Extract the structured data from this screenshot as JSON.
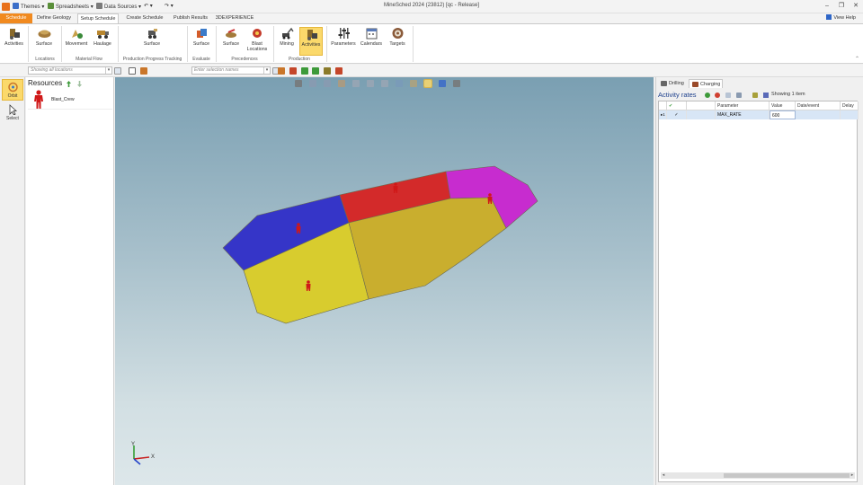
{
  "titlebar": {
    "title": "MineSched 2024 (23812) [qc - Release]",
    "quick_access": [
      "Themes",
      "Spreadsheets",
      "Data Sources"
    ]
  },
  "tabs": {
    "file": "Schedule",
    "items": [
      "Define Geology",
      "Setup Schedule",
      "Create Schedule",
      "Publish Results",
      "3DEXPERIENCE"
    ],
    "active": "Setup Schedule",
    "view_help": "View Help"
  },
  "ribbon": {
    "buttons": {
      "activities": "Activities",
      "loc_surface": "Surface",
      "movement": "Movement",
      "haulage": "Haulage",
      "ppt_surface": "Surface",
      "eval_surface": "Surface",
      "prec_surface": "Surface",
      "blast_locations": "Blast Locations",
      "mining": "Mining",
      "prod_activities": "Activities",
      "parameters": "Parameters",
      "calendars": "Calendars",
      "targets": "Targets"
    },
    "groups": {
      "locations": "Locations",
      "material_flow": "Material Flow",
      "production_progress_tracking": "Production Progress Tracking",
      "evaluate": "Evaluate",
      "precedences": "Precedences",
      "production": "Production"
    }
  },
  "toolbar": {
    "locations_placeholder": "Showing all locations",
    "selection_placeholder": "Enter selection names"
  },
  "left_tools": {
    "orbit": "Orbit",
    "select": "Select"
  },
  "resources": {
    "title": "Resources",
    "items": [
      {
        "label": "Blast_Crew"
      }
    ]
  },
  "viewport": {
    "axes": {
      "x": "X",
      "y": "Y"
    },
    "regions": [
      {
        "name": "blue",
        "color": "#3535c8"
      },
      {
        "name": "red",
        "color": "#d32a2a"
      },
      {
        "name": "magenta",
        "color": "#c72ccf"
      },
      {
        "name": "yellow",
        "color": "#d8cc2e"
      },
      {
        "name": "gold",
        "color": "#c9ae2e"
      }
    ]
  },
  "right_panel": {
    "tabs": [
      "Drilling",
      "Charging"
    ],
    "active_tab": "Charging",
    "title": "Activity rates",
    "showing": "Showing 1 item",
    "columns": [
      "",
      "",
      "",
      "Parameter",
      "Value",
      "Date/event",
      "Delay"
    ],
    "rows": [
      {
        "index": "1",
        "checked": "✓",
        "parameter": "MAX_RATE",
        "value": "600",
        "date_event": "",
        "delay": ""
      }
    ]
  },
  "colors": {
    "accent": "#f18a1f",
    "selected": "#fbd96b",
    "title_blue": "#1c3f8c"
  }
}
